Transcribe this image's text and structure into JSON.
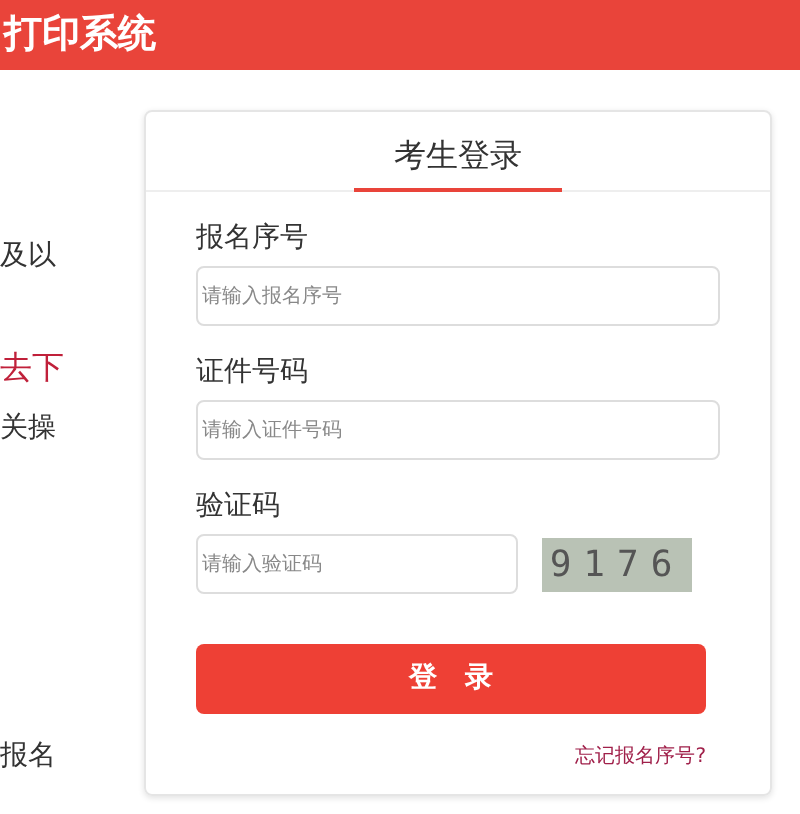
{
  "header": {
    "title": "打印系统"
  },
  "left_texts": [
    {
      "text": "及以",
      "kind": "plain"
    },
    {
      "text": "去下",
      "kind": "highlight"
    },
    {
      "text": "关操",
      "kind": "plain"
    },
    {
      "text": "报名",
      "kind": "plain"
    }
  ],
  "login": {
    "title": "考生登录",
    "fields": [
      {
        "label": "报名序号",
        "placeholder": "请输入报名序号",
        "kind": "text"
      },
      {
        "label": "证件号码",
        "placeholder": "请输入证件号码",
        "kind": "text"
      },
      {
        "label": "验证码",
        "placeholder": "请输入验证码",
        "kind": "captcha",
        "captcha": "9176"
      }
    ],
    "submit": "登　录",
    "forgot": "忘记报名序号?"
  }
}
